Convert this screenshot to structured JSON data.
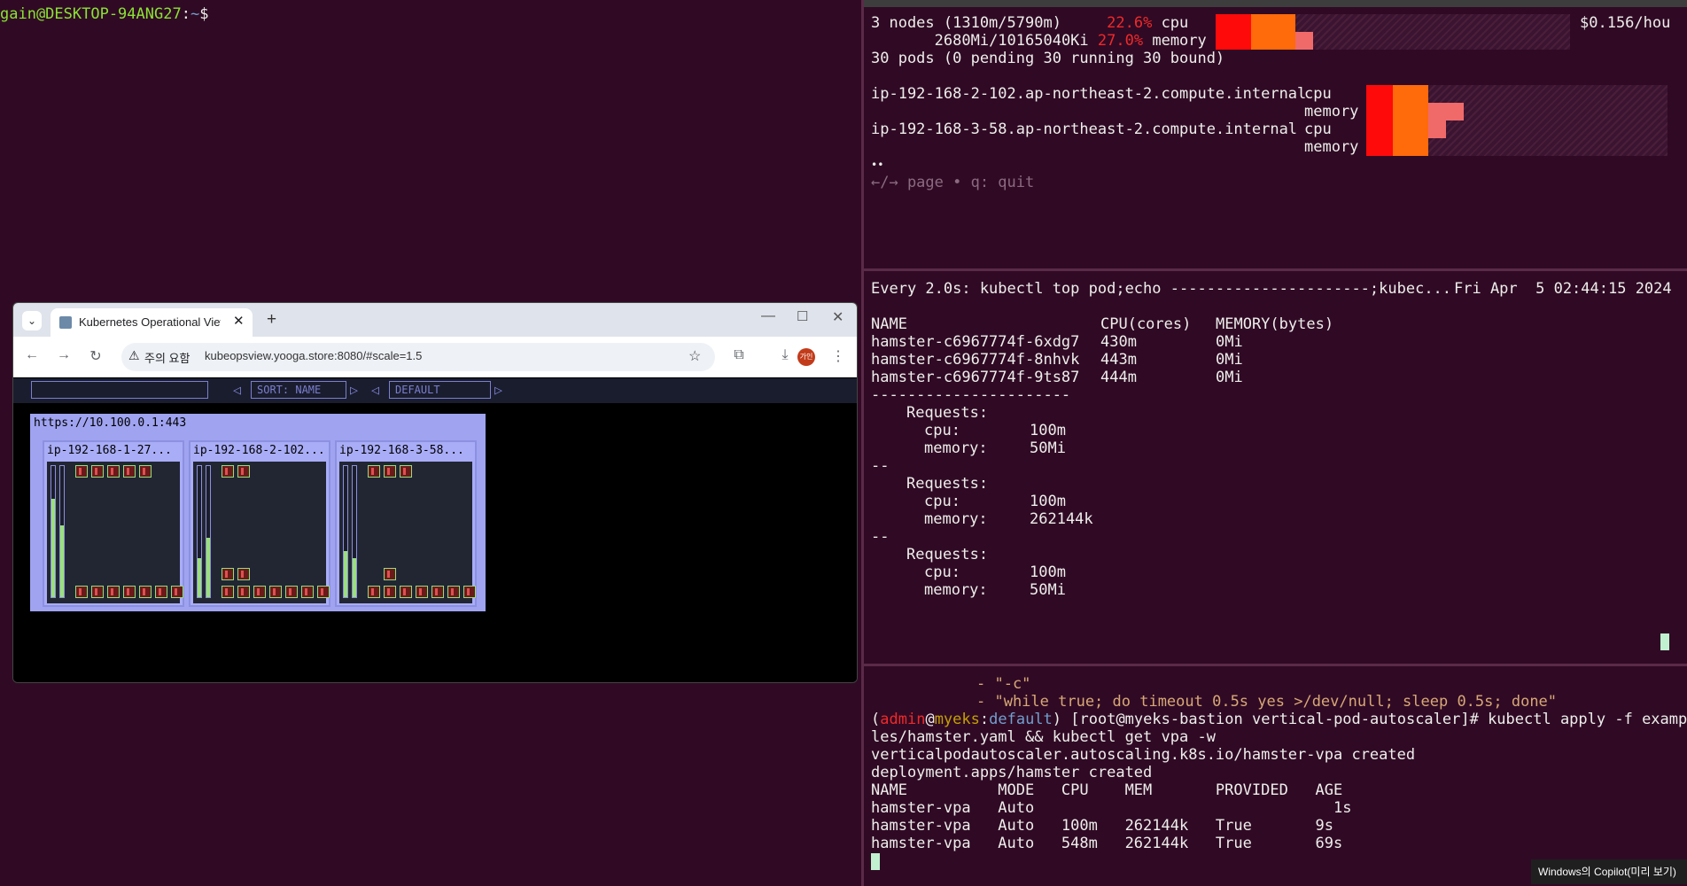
{
  "left_terminal": {
    "user_host": "gain@DESKTOP-94ANG27",
    "path": "~",
    "symbol": "$"
  },
  "capacity_pane": {
    "summary_line1_a": "3 nodes (1310m/5790m)",
    "cpu_pct": "22.6%",
    "cpu_label": "cpu",
    "summary_line2_a": "2680Mi/10165040Ki",
    "mem_pct": "27.0%",
    "mem_label": "memory",
    "cost": "$0.156/hou",
    "pods_line": "30 pods (0 pending 30 running 30 bound)",
    "nodes": [
      {
        "name": "ip-192-168-2-102.ap-northeast-2.compute.internal",
        "r1": "cpu",
        "r2": "memory"
      },
      {
        "name": "ip-192-168-3-58.ap-northeast-2.compute.internal",
        "r1": "cpu",
        "r2": "memory"
      }
    ],
    "dots": "••",
    "help": "←/→ page • q: quit"
  },
  "top_pane": {
    "header_left": "Every 2.0s: kubectl top pod;echo ----------------------;kubec...",
    "header_right": "Fri Apr  5 02:44:15 2024",
    "col_name": "NAME",
    "col_cpu": "CPU(cores)",
    "col_mem": "MEMORY(bytes)",
    "rows": [
      {
        "name": "hamster-c6967774f-6xdg7",
        "cpu": "430m",
        "mem": "0Mi"
      },
      {
        "name": "hamster-c6967774f-8nhvk",
        "cpu": "443m",
        "mem": "0Mi"
      },
      {
        "name": "hamster-c6967774f-9ts87",
        "cpu": "444m",
        "mem": "0Mi"
      }
    ],
    "sep": "----------------------",
    "requests_label": "Requests:",
    "cpu_key": "cpu:",
    "mem_key": "memory:",
    "dash": "--",
    "req": [
      {
        "cpu": "100m",
        "mem": "50Mi"
      },
      {
        "cpu": "100m",
        "mem": "262144k"
      },
      {
        "cpu": "100m",
        "mem": "50Mi"
      }
    ]
  },
  "bottom_pane": {
    "yaml1": "- \"-c\"",
    "yaml2": "- \"while true; do timeout 0.5s yes >/dev/null; sleep 0.5s; done\"",
    "p_open": "(",
    "p_user": "admin",
    "p_at": "@",
    "p_cluster": "myeks",
    "p_colon": ":",
    "p_ns": "default",
    "p_close": ")",
    "cmd1": " [root@myeks-bastion vertical-pod-autoscaler]# kubectl apply -f examp",
    "cmd2": "les/hamster.yaml && kubectl get vpa -w",
    "out1": "verticalpodautoscaler.autoscaling.k8s.io/hamster-vpa created",
    "out2": "deployment.apps/hamster created",
    "vpa_header": "NAME          MODE   CPU    MEM       PROVIDED   AGE",
    "vpa_rows": [
      "hamster-vpa   Auto                                 1s",
      "hamster-vpa   Auto   100m   262144k   True       9s",
      "hamster-vpa   Auto   548m   262144k   True       69s"
    ]
  },
  "browser": {
    "tab_title": "Kubernetes Operational View",
    "url": "kubeopsview.yooga.store:8080/#scale=1.5",
    "security_label": "주의 요함",
    "profile_label": "가인",
    "sort_label": "SORT: NAME",
    "default_label": "DEFAULT",
    "cluster_url": "https://10.100.0.1:443",
    "nodes": [
      "ip-192-168-1-27...",
      "ip-192-168-2-102...",
      "ip-192-168-3-58..."
    ]
  },
  "taskbar": {
    "copilot": "Windows의 Copilot(미리 보기)"
  }
}
